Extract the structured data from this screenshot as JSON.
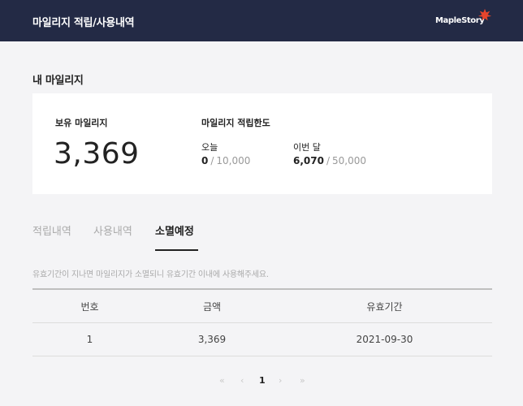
{
  "header": {
    "title": "마일리지 적립/사용내역",
    "logo_text": "MapleStory",
    "logo_accent": "#e8452c"
  },
  "mileage": {
    "section_title": "내 마일리지",
    "holding_label": "보유 마일리지",
    "holding_value": "3,369",
    "limit_label": "마일리지 적립한도",
    "today_label": "오늘",
    "today_used": "0",
    "today_max": "10,000",
    "month_label": "이번 달",
    "month_used": "6,070",
    "month_max": "50,000"
  },
  "tabs": [
    {
      "label": "적립내역",
      "active": false
    },
    {
      "label": "사용내역",
      "active": false
    },
    {
      "label": "소멸예정",
      "active": true
    }
  ],
  "notice": "유효기간이 지나면 마일리지가 소멸되니 유효기간 이내에 사용해주세요.",
  "table": {
    "headers": [
      "번호",
      "금액",
      "유효기간"
    ],
    "rows": [
      [
        "1",
        "3,369",
        "2021-09-30"
      ]
    ]
  },
  "pagination": {
    "first": "«",
    "prev": "‹",
    "current": "1",
    "next": "›",
    "last": "»"
  }
}
